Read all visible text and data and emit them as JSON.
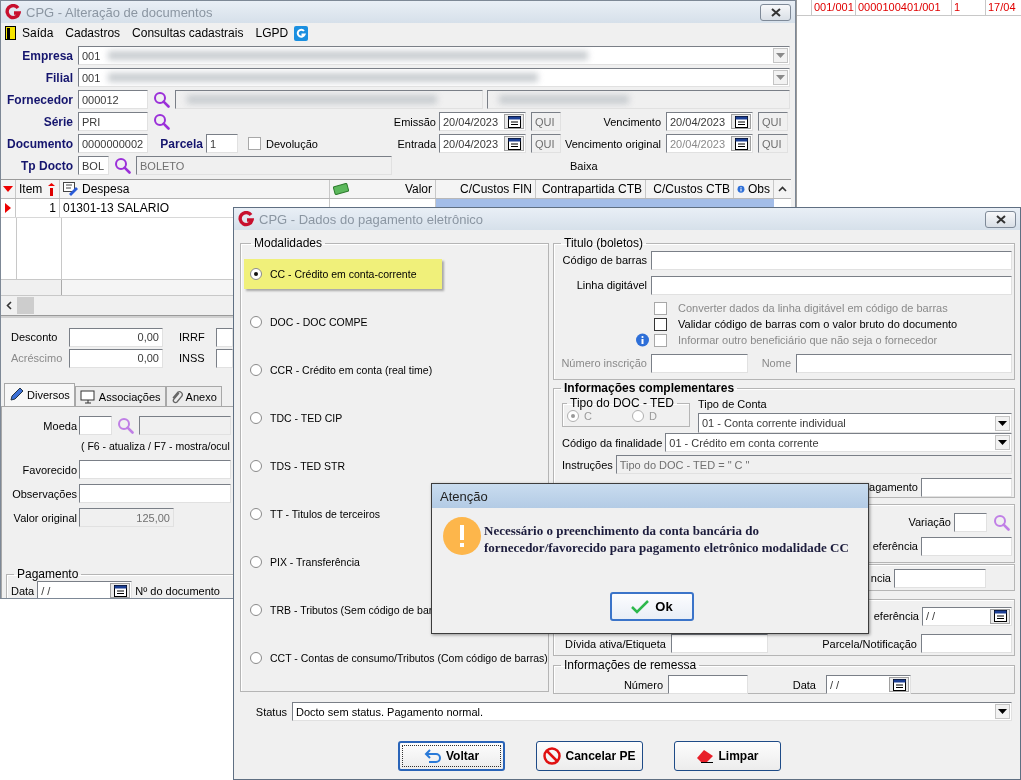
{
  "main_window": {
    "title": "CPG - Alteração de documentos",
    "menu": [
      "Saída",
      "Cadastros",
      "Consultas cadastrais",
      "LGPD"
    ],
    "empresa": {
      "label": "Empresa",
      "value": "001"
    },
    "filial": {
      "label": "Filial",
      "value": "001"
    },
    "fornecedor": {
      "label": "Fornecedor",
      "value": "000012"
    },
    "serie": {
      "label": "Série",
      "value": "PRI"
    },
    "documento": {
      "label": "Documento",
      "value": "0000000002"
    },
    "parcela": {
      "label": "Parcela",
      "value": "1"
    },
    "devolucao": {
      "label": "Devolução",
      "checked": false
    },
    "tp_docto": {
      "label": "Tp Docto",
      "code": "BOL",
      "description": "BOLETO"
    },
    "dates": [
      {
        "label": "Emissão",
        "value": "20/04/2023",
        "weekday": "QUI",
        "disabled": false
      },
      {
        "label": "Vencimento",
        "value": "20/04/2023",
        "weekday": "QUI",
        "disabled": false
      },
      {
        "label": "Entrada",
        "value": "20/04/2023",
        "weekday": "QUI",
        "disabled": false
      },
      {
        "label": "Vencimento original",
        "value": "20/04/2023",
        "weekday": "QUI",
        "disabled": true
      }
    ],
    "baixa": "Baixa",
    "grid": {
      "columns": [
        "Item",
        "Despesa",
        "Valor",
        "C/Custos FIN",
        "Contrapartida CTB",
        "C/Custos CTB",
        "Obs"
      ],
      "rows": [
        {
          "item": "1",
          "despesa": "01301-13 SALARIO",
          "selected": true
        }
      ]
    },
    "totals": [
      {
        "label": "Desconto",
        "value": "0,00",
        "disabled": false,
        "tax_label": "IRRF"
      },
      {
        "label": "Acréscimo",
        "value": "0,00",
        "disabled": true,
        "tax_label": "INSS"
      }
    ],
    "tabs": [
      {
        "label": "Diversos",
        "selected": true
      },
      {
        "label": "Associações",
        "selected": false
      },
      {
        "label": "Anexo",
        "selected": false
      }
    ],
    "diversos": {
      "moeda": "Moeda",
      "hint": "( F6 - atualiza / F7 - mostra/ocul",
      "favorecido": "Favorecido",
      "observacoes": "Observações",
      "valor_original": {
        "label": "Valor original",
        "value": "125,00"
      },
      "pagamento": {
        "title": "Pagamento",
        "data_label": "Data",
        "data_value": "/ /",
        "numero_label": "Nº do documento"
      }
    }
  },
  "side_grid": {
    "row": [
      "001/001",
      "0000100401/001",
      "1",
      "17/04"
    ]
  },
  "dialog": {
    "title": "CPG - Dados do pagamento eletrônico",
    "modalidades": {
      "title": "Modalidades",
      "options": [
        {
          "label": "CC  - Crédito em conta-corrente",
          "selected": true
        },
        {
          "label": "DOC - DOC COMPE",
          "selected": false
        },
        {
          "label": "CCR - Crédito em conta (real time)",
          "selected": false
        },
        {
          "label": "TDC - TED CIP",
          "selected": false
        },
        {
          "label": "TDS - TED STR",
          "selected": false
        },
        {
          "label": "TT  - Titulos de terceiros",
          "selected": false
        },
        {
          "label": "PIX - Transferência",
          "selected": false
        },
        {
          "label": "TRB - Tributos (Sem código de bar",
          "selected": false
        },
        {
          "label": "CCT - Contas de consumo/Tributos (Com código de barras)",
          "selected": false
        }
      ]
    },
    "titulo": {
      "title": "Titulo (boletos)",
      "codigo_barras": "Código de barras",
      "linha_digitavel": "Linha digitável",
      "options": [
        {
          "label": "Converter dados da linha digitável em código de barras",
          "checked": false,
          "disabled": true,
          "has_info": false
        },
        {
          "label": "Validar código de barras com o valor bruto do documento",
          "checked": false,
          "disabled": false,
          "has_info": false
        },
        {
          "label": "Informar outro beneficiário que não seja o fornecedor",
          "checked": false,
          "disabled": true,
          "has_info": true
        }
      ],
      "numero_inscricao": "Número inscrição",
      "nome": "Nome"
    },
    "complementares": {
      "title": "Informações complementares",
      "tipo_doc_ted": {
        "title": "Tipo do DOC - TED",
        "disabled": true,
        "options": [
          {
            "label": "C",
            "selected": true
          },
          {
            "label": "D",
            "selected": false
          }
        ]
      },
      "tipo_conta": {
        "label": "Tipo de Conta",
        "value": "01 - Conta corrente individual"
      },
      "finalidade": {
        "label": "Código da finalidade",
        "value": "01 - Crédito em conta corrente"
      },
      "instrucoes": {
        "label": "Instruções",
        "value": "Tipo do DOC - TED = \" C \""
      },
      "codigo_pagamento": "agamento"
    },
    "partial": {
      "variacao": "Variação",
      "referencia": "eferência",
      "agencia": "ncia",
      "data_referencia": "eferência",
      "data_referencia_value": "/ /",
      "divida": "Dívida ativa/Etiqueta",
      "parcela": "Parcela/Notificação"
    },
    "remessa": {
      "title": "Informações de remessa",
      "numero": "Número",
      "data": "Data",
      "data_value": "/ /"
    },
    "status": {
      "label": "Status",
      "value": "Docto sem status. Pagamento normal."
    },
    "buttons": [
      {
        "label": "Voltar",
        "kind": "back",
        "default": true
      },
      {
        "label": "Cancelar PE",
        "kind": "cancel",
        "default": false
      },
      {
        "label": "Limpar",
        "kind": "clear",
        "default": false
      }
    ]
  },
  "alert": {
    "title": "Atenção",
    "message": "Necessário o preenchimento da conta bancária do fornecedor/favorecido para pagamento eletrônico modalidade CC",
    "button": "Ok"
  }
}
